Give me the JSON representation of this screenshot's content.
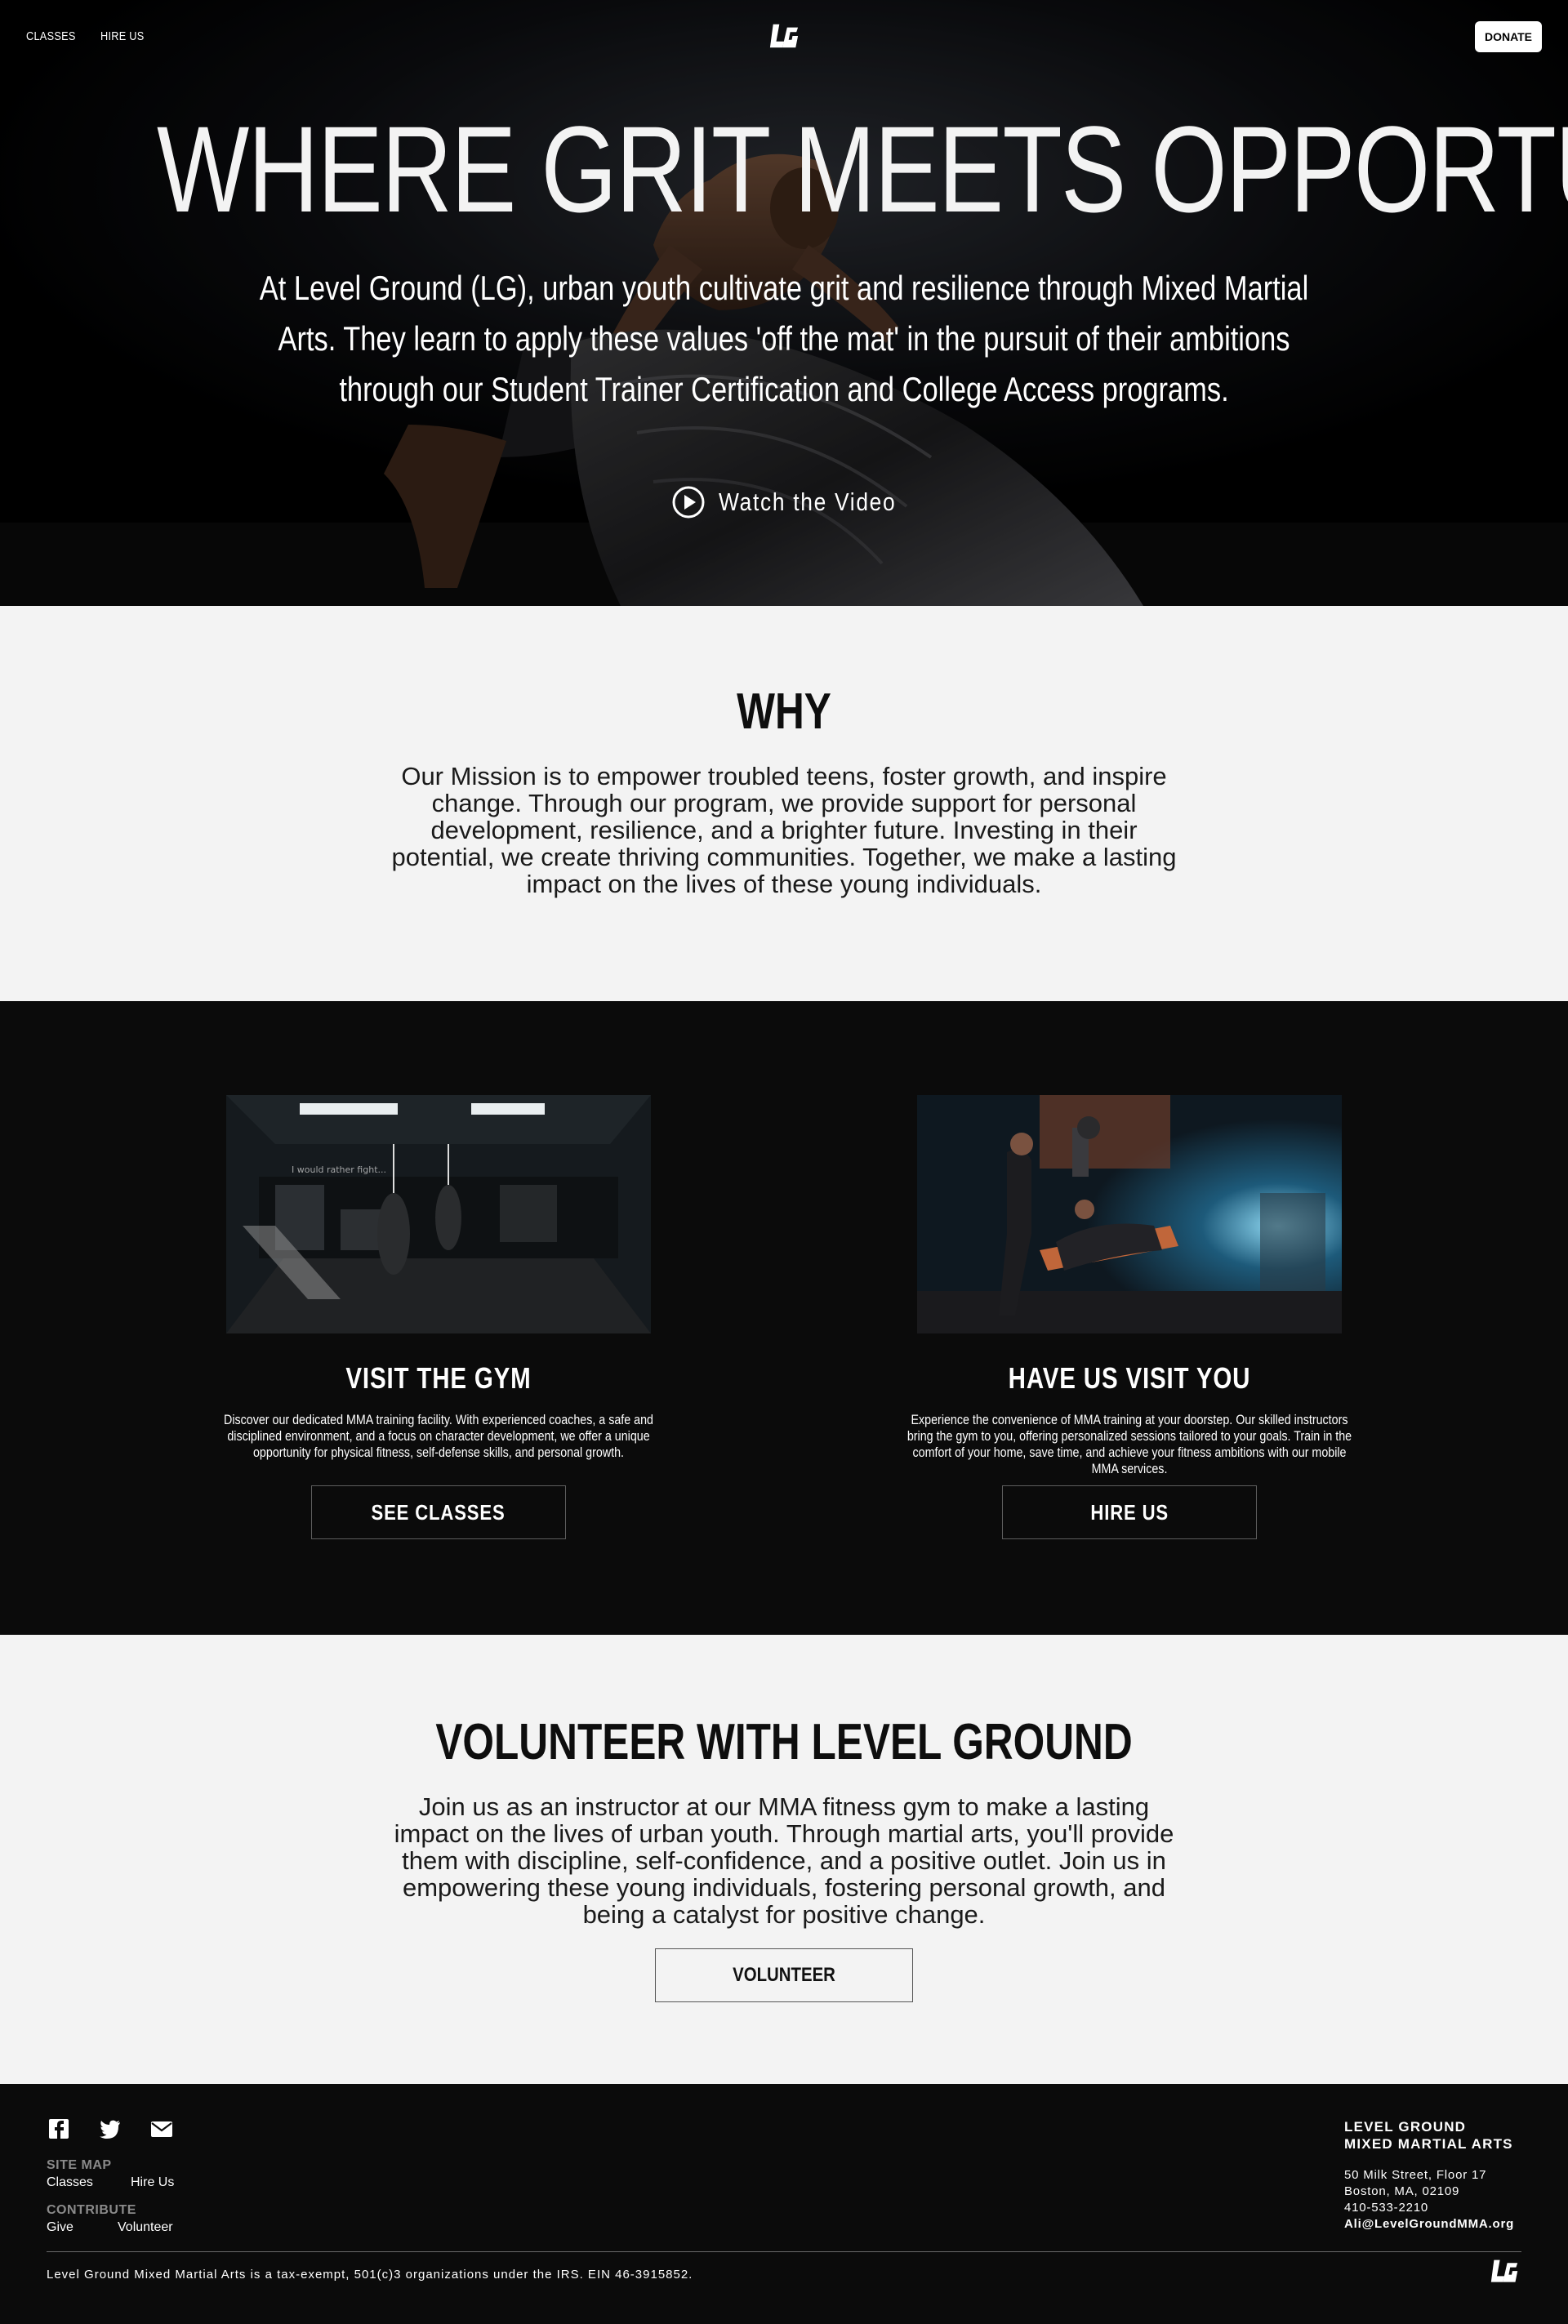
{
  "nav": {
    "links": [
      "CLASSES",
      "HIRE US"
    ],
    "logo_text": "LG",
    "donate_label": "DONATE"
  },
  "hero": {
    "title": "WHERE GRIT MEETS OPPORTUNITY",
    "subtitle": "At Level Ground (LG), urban youth cultivate grit and resilience through Mixed Martial Arts. They learn to apply these values 'off the mat' in the pursuit of their ambitions through our Student Trainer Certification and College Access programs.",
    "watch_label": "Watch the Video",
    "watch_icon": "play-circle-icon"
  },
  "why": {
    "title": "WHY",
    "text": "Our Mission is to empower troubled teens, foster growth, and inspire change. Through our program, we provide support for personal development, resilience, and a brighter future. Investing in their potential, we create thriving communities. Together, we make a lasting impact on the lives of these young individuals."
  },
  "cards": [
    {
      "title": "VISIT THE GYM",
      "text": "Discover our dedicated MMA training facility. With experienced coaches, a safe and disciplined environment, and a focus on character development, we offer a unique opportunity for physical fitness, self-defense skills, and personal growth.",
      "button": "SEE CLASSES"
    },
    {
      "title": "HAVE US VISIT YOU",
      "text": "Experience the convenience of MMA training at your doorstep. Our skilled instructors bring the gym to you, offering personalized sessions tailored to your goals. Train in the comfort of your home, save time, and achieve your fitness ambitions with our mobile MMA services.",
      "button": "HIRE US"
    }
  ],
  "volunteer": {
    "title": "VOLUNTEER WITH LEVEL GROUND",
    "text": "Join us as an instructor at our MMA fitness gym to make a lasting impact on the lives of urban youth. Through martial arts, you'll provide them with discipline, self-confidence, and a positive outlet. Join us in empowering these young individuals, fostering personal growth, and being a catalyst for positive change.",
    "button": "VOLUNTEER"
  },
  "footer": {
    "social_icons": [
      "facebook-icon",
      "twitter-icon",
      "email-icon"
    ],
    "site_map_label": "SITE MAP",
    "site_map_links": [
      "Classes",
      "Hire Us"
    ],
    "contribute_label": "CONTRIBUTE",
    "contribute_links": [
      "Give",
      "Volunteer"
    ],
    "org_name_1": "LEVEL GROUND",
    "org_name_2": "MIXED MARTIAL ARTS",
    "address_1": "50 Milk Street, Floor 17",
    "address_2": "Boston, MA, 02109",
    "phone": "410-533-2210",
    "email": "Ali@LevelGroundMMA.org",
    "legal": "Level Ground Mixed Martial Arts is a tax-exempt, 501(c)3 organizations under the IRS. EIN 46-3915852."
  },
  "colors": {
    "dark": "#0b0b0b",
    "light": "#f3f3f3",
    "accent_orange": "#c8582a"
  }
}
